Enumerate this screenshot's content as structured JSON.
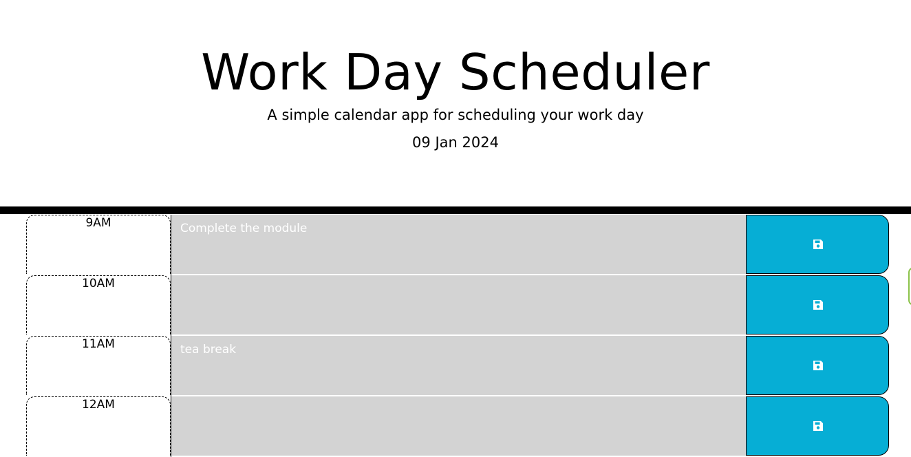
{
  "header": {
    "title": "Work Day Scheduler",
    "subtitle": "A simple calendar app for scheduling your work day",
    "current_day": "09 Jan 2024"
  },
  "schedule": {
    "rows": [
      {
        "hour": "9AM",
        "description": "Complete the module",
        "save_icon": "save-icon"
      },
      {
        "hour": "10AM",
        "description": "",
        "save_icon": "save-icon"
      },
      {
        "hour": "11AM",
        "description": "tea break",
        "save_icon": "save-icon"
      },
      {
        "hour": "12AM",
        "description": "",
        "save_icon": "save-icon"
      }
    ]
  },
  "colors": {
    "save_button": "#06aed5",
    "past_block": "#d3d3d3",
    "description_text": "#ffffff",
    "divider": "#000000",
    "edge_tab": "#8bc34a"
  }
}
